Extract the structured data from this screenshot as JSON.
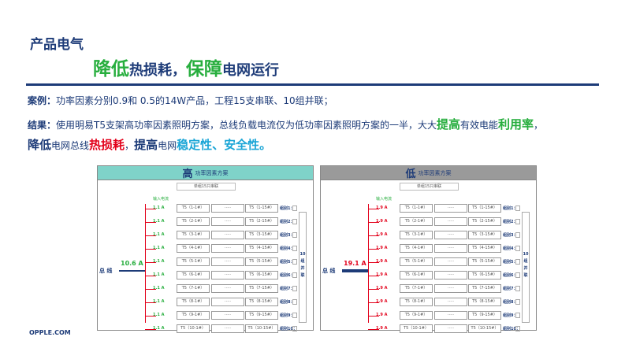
{
  "section_title": "产品电气",
  "headline": {
    "part1_big": "降低",
    "part1_rest": "热损耗，",
    "part2_big": "保障",
    "part2_rest": "电网运行"
  },
  "case": {
    "label": "案例：",
    "text": "功率因素分别0.9和 0.5的14W产品，工程15支串联、10组并联；"
  },
  "result": {
    "label": "结果：",
    "text_a": "使用明易T5支架高功率因素照明方案，总线负载电流仅为低功率因素照明方案的一半，大大",
    "emph1": "提高",
    "text_b": "有效电能",
    "emph2": "利用率",
    "text_c": "，",
    "line3_e1": "降低",
    "line3_t1": "电网总线",
    "line3_e2": "热损耗",
    "line3_t2": "，",
    "line3_e3": "提高",
    "line3_t3": "电网",
    "line3_e4": "稳定性、安全性。"
  },
  "footer": "OPPLE.COM",
  "colors": {
    "navy": "#1d3b78",
    "green": "#27ae3e",
    "red": "#e2001a",
    "cyan": "#1aa5d6",
    "teal": "#7fd3c9",
    "gray": "#9a9a9a"
  },
  "panels": [
    {
      "level": "高",
      "title": "功率因素方案",
      "single": "单组15只串联",
      "input_label": "输入电流",
      "bus_label": "总 线",
      "total_current": "10.6 A",
      "branch_current": "1.1 A",
      "amp_color": "#27ae3e",
      "brace_text": "10组并联",
      "rows": [
        {
          "c1": "T5（1-1#）",
          "c2": "·····",
          "c3": "T5（1-15#）",
          "grp": "组别1："
        },
        {
          "c1": "T5（2-1#）",
          "c2": "·····",
          "c3": "T5（2-15#）",
          "grp": "组别2："
        },
        {
          "c1": "T5（3-1#）",
          "c2": "·····",
          "c3": "T5（3-15#）",
          "grp": "组别3："
        },
        {
          "c1": "T5（4-1#）",
          "c2": "·····",
          "c3": "T5（4-15#）",
          "grp": "组别4："
        },
        {
          "c1": "T5（5-1#）",
          "c2": "·····",
          "c3": "T5（5-15#）",
          "grp": "组别5："
        },
        {
          "c1": "T5（6-1#）",
          "c2": "·····",
          "c3": "T5（6-15#）",
          "grp": "组别6："
        },
        {
          "c1": "T5（7-1#）",
          "c2": "·····",
          "c3": "T5（7-15#）",
          "grp": "组别7："
        },
        {
          "c1": "T5（8-1#）",
          "c2": "·····",
          "c3": "T5（8-15#）",
          "grp": "组别8："
        },
        {
          "c1": "T5（9-1#）",
          "c2": "·····",
          "c3": "T5（9-15#）",
          "grp": "组别9："
        },
        {
          "c1": "T5（10-1#）",
          "c2": "·····",
          "c3": "T5（10-15#）",
          "grp": "组别10："
        }
      ]
    },
    {
      "level": "低",
      "title": "功率因素方案",
      "single": "单组15只串联",
      "input_label": "输入电流",
      "bus_label": "总 线",
      "total_current": "19.1 A",
      "branch_current": "1.9 A",
      "amp_color": "#e2001a",
      "brace_text": "10组并联",
      "rows": [
        {
          "c1": "T5（1-1#）",
          "c2": "·····",
          "c3": "T5（1-15#）",
          "grp": "组别1："
        },
        {
          "c1": "T5（2-1#）",
          "c2": "·····",
          "c3": "T5（2-15#）",
          "grp": "组别2："
        },
        {
          "c1": "T5（3-1#）",
          "c2": "·····",
          "c3": "T5（3-15#）",
          "grp": "组别3："
        },
        {
          "c1": "T5（4-1#）",
          "c2": "·····",
          "c3": "T5（4-15#）",
          "grp": "组别4："
        },
        {
          "c1": "T5（5-1#）",
          "c2": "·····",
          "c3": "T5（5-15#）",
          "grp": "组别5："
        },
        {
          "c1": "T5（6-1#）",
          "c2": "·····",
          "c3": "T5（6-15#）",
          "grp": "组别6："
        },
        {
          "c1": "T5（7-1#）",
          "c2": "·····",
          "c3": "T5（7-15#）",
          "grp": "组别7："
        },
        {
          "c1": "T5（8-1#）",
          "c2": "·····",
          "c3": "T5（8-15#）",
          "grp": "组别8："
        },
        {
          "c1": "T5（9-1#）",
          "c2": "·····",
          "c3": "T5（9-15#）",
          "grp": "组别9："
        },
        {
          "c1": "T5（10-1#）",
          "c2": "·····",
          "c3": "T5（10-15#）",
          "grp": "组别10："
        }
      ]
    }
  ]
}
